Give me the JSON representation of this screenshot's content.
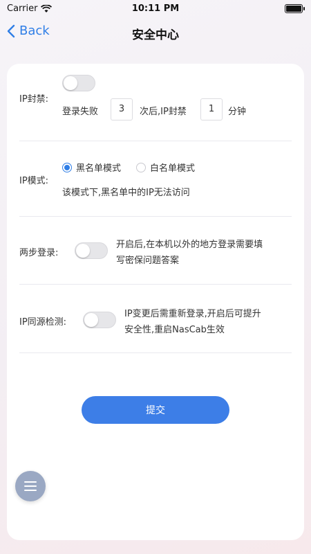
{
  "status": {
    "carrier": "Carrier",
    "time": "10:11 PM"
  },
  "nav": {
    "back_label": "Back",
    "title": "安全中心"
  },
  "ip_ban": {
    "label": "IP封禁:",
    "prefix": "登录失败",
    "fail_count": "3",
    "middle": "次后,IP封禁",
    "ban_minutes": "1",
    "suffix": "分钟",
    "enabled": false
  },
  "ip_mode": {
    "label": "IP模式:",
    "options": [
      "黑名单模式",
      "白名单模式"
    ],
    "selected": "黑名单模式",
    "description": "该模式下,黑名单中的IP无法访问"
  },
  "two_step": {
    "label": "两步登录:",
    "enabled": false,
    "description_line1": "开启后,在本机以外的地方登录需要填",
    "description_line2": "写密保问题答案"
  },
  "ip_origin": {
    "label": "IP同源检测:",
    "enabled": false,
    "description_line1": "IP变更后需重新登录,开启后可提升",
    "description_line2": "安全性,重启NasCab生效"
  },
  "submit_label": "提交",
  "colors": {
    "accent": "#2f7ee6",
    "button": "#3d7ee7",
    "fab": "#9aa8c3"
  },
  "fab_icon": "menu-icon"
}
